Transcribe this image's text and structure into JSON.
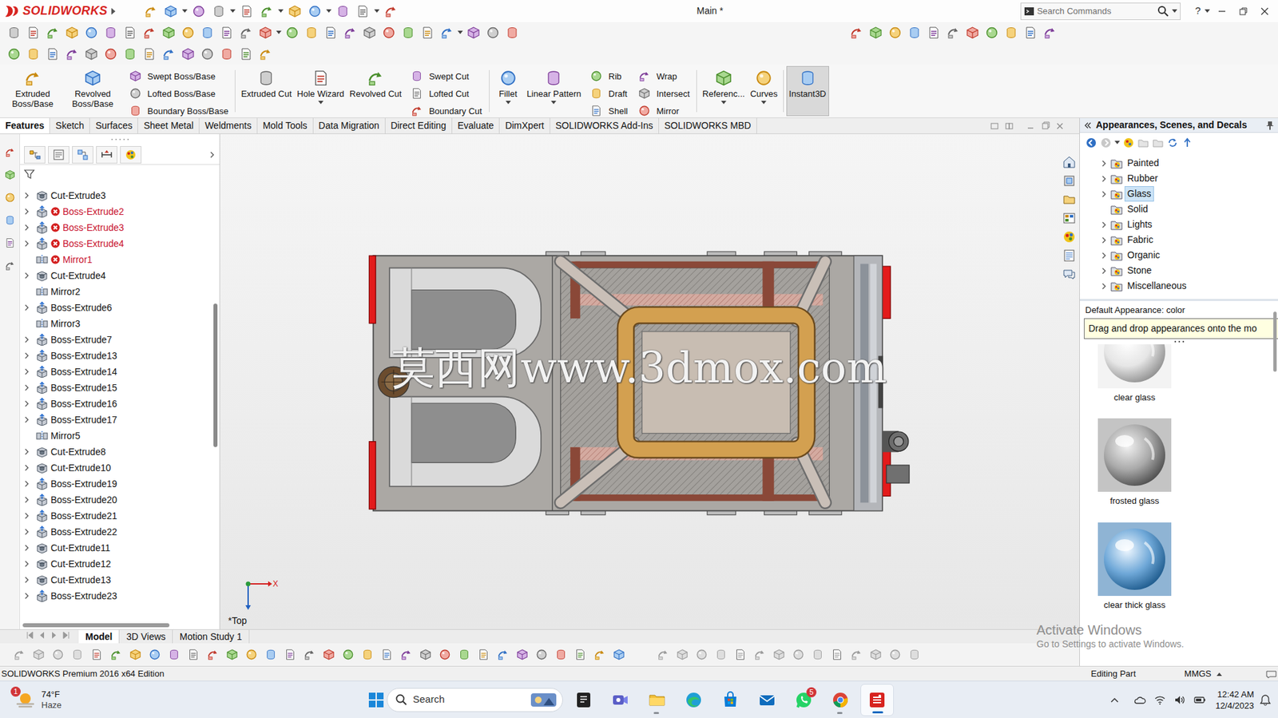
{
  "window": {
    "title": "Main *",
    "app": "SOLIDWORKS",
    "help": "?"
  },
  "search": {
    "placeholder": "Search Commands"
  },
  "ribbon": [
    {
      "kind": "large",
      "label": "Extruded Boss/Base",
      "dropdown": false,
      "on": false
    },
    {
      "kind": "large",
      "label": "Revolved Boss/Base",
      "dropdown": false,
      "on": false
    },
    {
      "kind": "stack",
      "items": [
        "Swept Boss/Base",
        "Lofted Boss/Base",
        "Boundary Boss/Base"
      ]
    },
    {
      "kind": "large",
      "label": "Extruded Cut",
      "dropdown": false,
      "on": false
    },
    {
      "kind": "large",
      "label": "Hole Wizard",
      "dropdown": true,
      "on": false
    },
    {
      "kind": "large",
      "label": "Revolved Cut",
      "dropdown": false,
      "on": false
    },
    {
      "kind": "stack",
      "items": [
        "Swept Cut",
        "Lofted Cut",
        "Boundary Cut"
      ]
    },
    {
      "kind": "large",
      "label": "Fillet",
      "dropdown": true,
      "on": false
    },
    {
      "kind": "large",
      "label": "Linear Pattern",
      "dropdown": true,
      "on": false
    },
    {
      "kind": "stack",
      "items": [
        "Rib",
        "Draft",
        "Shell"
      ]
    },
    {
      "kind": "stack",
      "items": [
        "Wrap",
        "Intersect",
        "Mirror"
      ]
    },
    {
      "kind": "large",
      "label": "Referenc...",
      "dropdown": true,
      "on": false
    },
    {
      "kind": "large",
      "label": "Curves",
      "dropdown": true,
      "on": false
    },
    {
      "kind": "large",
      "label": "Instant3D",
      "dropdown": false,
      "on": true
    }
  ],
  "tabs": [
    {
      "label": "Features",
      "selected": true
    },
    {
      "label": "Sketch",
      "selected": false
    },
    {
      "label": "Surfaces",
      "selected": false
    },
    {
      "label": "Sheet Metal",
      "selected": false
    },
    {
      "label": "Weldments",
      "selected": false
    },
    {
      "label": "Mold Tools",
      "selected": false
    },
    {
      "label": "Data Migration",
      "selected": false
    },
    {
      "label": "Direct Editing",
      "selected": false
    },
    {
      "label": "Evaluate",
      "selected": false
    },
    {
      "label": "DimXpert",
      "selected": false
    },
    {
      "label": "SOLIDWORKS Add-Ins",
      "selected": false
    },
    {
      "label": "SOLIDWORKS MBD",
      "selected": false
    }
  ],
  "feature_tree": {
    "items": [
      {
        "label": "Cut-Extrude3",
        "kind": "cut",
        "expandable": true,
        "error": false
      },
      {
        "label": "Boss-Extrude2",
        "kind": "boss",
        "expandable": true,
        "error": true
      },
      {
        "label": "Boss-Extrude3",
        "kind": "boss",
        "expandable": true,
        "error": true
      },
      {
        "label": "Boss-Extrude4",
        "kind": "boss",
        "expandable": true,
        "error": true
      },
      {
        "label": "Mirror1",
        "kind": "mirror",
        "expandable": false,
        "error": true
      },
      {
        "label": "Cut-Extrude4",
        "kind": "cut",
        "expandable": true,
        "error": false
      },
      {
        "label": "Mirror2",
        "kind": "mirror",
        "expandable": false,
        "error": false
      },
      {
        "label": "Boss-Extrude6",
        "kind": "boss",
        "expandable": true,
        "error": false
      },
      {
        "label": "Mirror3",
        "kind": "mirror",
        "expandable": false,
        "error": false
      },
      {
        "label": "Boss-Extrude7",
        "kind": "boss",
        "expandable": true,
        "error": false
      },
      {
        "label": "Boss-Extrude13",
        "kind": "boss",
        "expandable": true,
        "error": false
      },
      {
        "label": "Boss-Extrude14",
        "kind": "boss",
        "expandable": true,
        "error": false
      },
      {
        "label": "Boss-Extrude15",
        "kind": "boss",
        "expandable": true,
        "error": false
      },
      {
        "label": "Boss-Extrude16",
        "kind": "boss",
        "expandable": true,
        "error": false
      },
      {
        "label": "Boss-Extrude17",
        "kind": "boss",
        "expandable": true,
        "error": false
      },
      {
        "label": "Mirror5",
        "kind": "mirror",
        "expandable": false,
        "error": false
      },
      {
        "label": "Cut-Extrude8",
        "kind": "cut",
        "expandable": true,
        "error": false
      },
      {
        "label": "Cut-Extrude10",
        "kind": "cut",
        "expandable": true,
        "error": false
      },
      {
        "label": "Boss-Extrude19",
        "kind": "boss",
        "expandable": true,
        "error": false
      },
      {
        "label": "Boss-Extrude20",
        "kind": "boss",
        "expandable": true,
        "error": false
      },
      {
        "label": "Boss-Extrude21",
        "kind": "boss",
        "expandable": true,
        "error": false
      },
      {
        "label": "Boss-Extrude22",
        "kind": "boss",
        "expandable": true,
        "error": false
      },
      {
        "label": "Cut-Extrude11",
        "kind": "cut",
        "expandable": true,
        "error": false
      },
      {
        "label": "Cut-Extrude12",
        "kind": "cut",
        "expandable": true,
        "error": false
      },
      {
        "label": "Cut-Extrude13",
        "kind": "cut",
        "expandable": true,
        "error": false
      },
      {
        "label": "Boss-Extrude23",
        "kind": "boss",
        "expandable": true,
        "error": false
      }
    ]
  },
  "graphics": {
    "view_label": "*Top",
    "axis_label": "X",
    "watermark": "莫西网www.3dmox.com"
  },
  "task_pane": {
    "title": "Appearances, Scenes, and Decals",
    "items": [
      {
        "label": "Painted",
        "expandable": true,
        "selected": false
      },
      {
        "label": "Rubber",
        "expandable": true,
        "selected": false
      },
      {
        "label": "Glass",
        "expandable": true,
        "selected": true
      },
      {
        "label": "Solid",
        "expandable": false,
        "selected": false
      },
      {
        "label": "Lights",
        "expandable": true,
        "selected": false
      },
      {
        "label": "Fabric",
        "expandable": true,
        "selected": false
      },
      {
        "label": "Organic",
        "expandable": true,
        "selected": false
      },
      {
        "label": "Stone",
        "expandable": true,
        "selected": false
      },
      {
        "label": "Miscellaneous",
        "expandable": true,
        "selected": false
      }
    ],
    "caption": "Default Appearance: color",
    "tooltip": "Drag and drop appearances onto the mo",
    "thumbnails": [
      {
        "label": "clear glass",
        "kind": "clear"
      },
      {
        "label": "frosted glass",
        "kind": "frosted"
      },
      {
        "label": "clear thick glass",
        "kind": "thick"
      }
    ]
  },
  "bottom_tabs": [
    {
      "label": "Model",
      "selected": true
    },
    {
      "label": "3D Views",
      "selected": false
    },
    {
      "label": "Motion Study 1",
      "selected": false
    }
  ],
  "status_bar": {
    "edition": "SOLIDWORKS Premium 2016 x64 Edition",
    "mode": "Editing Part",
    "units": "MMGS"
  },
  "os_watermark": {
    "title": "Activate Windows",
    "subtitle": "Go to Settings to activate Windows."
  },
  "taskbar": {
    "weather": {
      "temp": "74°F",
      "condition": "Haze",
      "badge": "1"
    },
    "search": "Search",
    "apps": [
      {
        "kind": "dark",
        "running": false,
        "active": false,
        "badge": ""
      },
      {
        "kind": "teams",
        "running": false,
        "active": false,
        "badge": ""
      },
      {
        "kind": "explorer",
        "running": true,
        "active": false,
        "badge": ""
      },
      {
        "kind": "edge",
        "running": false,
        "active": false,
        "badge": ""
      },
      {
        "kind": "store",
        "running": false,
        "active": false,
        "badge": ""
      },
      {
        "kind": "mail",
        "running": false,
        "active": false,
        "badge": ""
      },
      {
        "kind": "whatsapp",
        "running": false,
        "active": false,
        "badge": "5"
      },
      {
        "kind": "chrome",
        "running": true,
        "active": false,
        "badge": ""
      },
      {
        "kind": "solidworks",
        "running": true,
        "active": true,
        "badge": ""
      }
    ],
    "clock": {
      "time": "12:42 AM",
      "date": "12/4/2023"
    }
  }
}
